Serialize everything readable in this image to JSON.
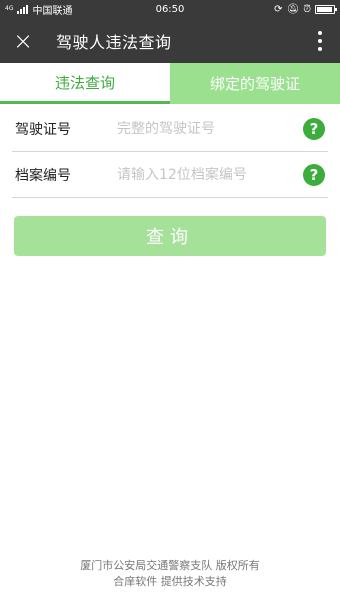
{
  "status_bar": {
    "network": "4G",
    "carrier": "中国联通",
    "time": "06:50",
    "icons": [
      "signal-bars-icon",
      "sync-icon",
      "mute-icon",
      "alarm-icon",
      "battery-icon"
    ]
  },
  "titlebar": {
    "close_icon": "×",
    "title": "驾驶人违法查询",
    "more_icon": "more-vertical-icon"
  },
  "tabs": [
    {
      "label": "违法查询",
      "active": true
    },
    {
      "label": "绑定的驾驶证",
      "active": false
    }
  ],
  "form": {
    "license": {
      "label": "驾驶证号",
      "placeholder": "完整的驾驶证号",
      "value": ""
    },
    "file_no": {
      "label": "档案编号",
      "placeholder": "请输入12位档案编号",
      "value": ""
    },
    "help_glyph": "?"
  },
  "query_button": "查询",
  "footer": {
    "line1": "厦门市公安局交通警察支队 版权所有",
    "line2": "合庠软件 提供技术支持"
  },
  "colors": {
    "accent": "#3cad3c",
    "tab_inactive": "#9be08e",
    "button": "#a6e199",
    "bar": "#3a3a3a"
  }
}
